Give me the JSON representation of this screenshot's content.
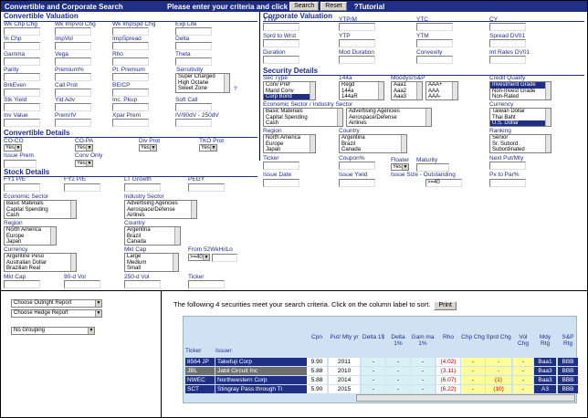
{
  "header": {
    "title": "Convertible and Corporate Search",
    "prompt": "Please enter your criteria and click",
    "search_label": "Search",
    "reset_label": "Reset",
    "tutorial_label": "?Tutorial"
  },
  "convertible_valuation": {
    "title": "Convertible Valuation",
    "fields": [
      "Wk Chp Chg",
      "Wk ImpVol Chg",
      "Wk ImpSpd Chg",
      "Exp Life",
      "% Chp",
      "ImpVol",
      "ImpSpread",
      "Delta",
      "Gamma",
      "Vega",
      "Rho",
      "Theta",
      "Parity",
      "Premium%",
      "Pt. Premium",
      "BrkEven",
      "Call Prot",
      "BE/CP",
      "Stk Yield",
      "Yld Adv",
      "Inc. Pkup",
      "Soft Call",
      "Inv Value",
      "Prem/IV",
      "Xpar Prem",
      "IV/90dV - 250dV"
    ],
    "sensitivity_label": "Sensitivity",
    "sensitivity_options": [
      "Super Charged",
      "High Octane",
      "Sweet Zone"
    ],
    "help": "?"
  },
  "corporate_valuation": {
    "title": "Corporate Valuation",
    "fields": [
      "YTW",
      "YTP/M",
      "YTC",
      "CY",
      "Sprd to Wrst",
      "YTP",
      "YTM",
      "Spread DV01",
      "Duration",
      "Mod Duration",
      "Convexity",
      "Int Rates DV01"
    ]
  },
  "security_details": {
    "title": "Security Details",
    "sec_type_label": "Sec Type",
    "sec_type_options": [
      "Conv Pref",
      "Mand Conv",
      "Corp Bond"
    ],
    "l144a_label": "144a",
    "l144a_options": [
      "Regd",
      "144a",
      "144aR"
    ],
    "moodys_label": "Moodys/S&P",
    "moodys_options": [
      "Aaa1",
      "Aaa2",
      "Aaa3"
    ],
    "sp_options": [
      "AAA+",
      "AAA",
      "AAA-"
    ],
    "credit_label": "Credit Quality",
    "credit_options": [
      "Investment Grade",
      "Non-Invest Grade",
      "Non-Rated"
    ],
    "econ_label": "Economic Sector / Industry Sector",
    "econ_options": [
      "Basic Materials",
      "Capital Spending",
      "Cash"
    ],
    "industry_options": [
      "Advertising Agencies",
      "Aerospace/Defense",
      "Airlines"
    ],
    "currency_label": "Currency",
    "currency_options": [
      "Taiwan Dollar",
      "Thai Baht",
      "U.S. Dollar"
    ],
    "region_label": "Region",
    "region_options": [
      "North America",
      "Europe",
      "Japan"
    ],
    "country_label": "Country",
    "country_options": [
      "Argentina",
      "Brazil",
      "Canada"
    ],
    "ranking_label": "Ranking",
    "ranking_options": [
      "Senior",
      "Sr. Subord.",
      "Subordinated"
    ],
    "ticker_label": "Ticker",
    "coupon_label": "Coupon%",
    "floater_label": "Floater",
    "floater_value": "Yes",
    "maturity_label": "Maturity",
    "next_put_label": "Next Put/Mty",
    "issue_date_label": "Issue Date",
    "issue_yield_label": "Issue Yield",
    "issue_size_label": "Issue Size  - Outstanding",
    "issue_size_value": ">=40",
    "px_par_label": "Px to Par%"
  },
  "convertible_details": {
    "title": "Convertible Details",
    "co_co_label": "CO-CO",
    "co_co_value": "Yes",
    "co_pa_label": "CO-PA",
    "co_pa_value": "Yes",
    "div_prot_label": "Div Prot",
    "div_prot_value": "Yes",
    "tko_prot_label": "TKO Prot",
    "tko_prot_value": "Yes",
    "issue_prem_label": "Issue Prem",
    "conv_only_label": "Conv Only",
    "conv_only_value": "Yes"
  },
  "stock_details": {
    "title": "Stock Details",
    "fy1_label": "FY1 P/E",
    "fy2_label": "FY2 P/E",
    "lt_growth_label": "LT Growth",
    "pegy_label": "PEGY",
    "econ_label": "Economic Sector",
    "econ_options": [
      "Basic Materials",
      "Capital Spending",
      "Cash"
    ],
    "industry_label": "Industry Sector",
    "industry_options": [
      "Advertising Agencies",
      "Aerospace/Defense",
      "Airlines"
    ],
    "region_label": "Region",
    "region_options": [
      "North America",
      "Europe",
      "Japan"
    ],
    "country_label": "Country",
    "country_options": [
      "Argentina",
      "Brazil",
      "Canada"
    ],
    "currency_label": "Currency",
    "currency_options": [
      "Argentine Peso",
      "Australian Dollar",
      "Brazilian Real"
    ],
    "mkt_cap_cat_label": "Mkt Cap",
    "mkt_cap_options": [
      "Large",
      "Medium",
      "Small"
    ],
    "from52_label": "From 52WkHi/Lo",
    "from52_value": ">=40",
    "mkt_cap_label": "Mkt Cap",
    "vol90_label": "90-d Vol",
    "vol250_label": "250-d Vol",
    "ticker_label": "Ticker"
  },
  "reports": {
    "outright": "Choose Outright Report",
    "hedge": "Choose Hedge Report",
    "grouping": "No Grouping"
  },
  "results": {
    "message": "The following 4 securities meet your search criteria. Click on the column label to sort.",
    "print_label": "Print",
    "columns": [
      "Ticker",
      "Issuer",
      "Cpn",
      "Put/ Mty yr",
      "Delta 1$",
      "Delta 1%",
      "Gam ma 1%",
      "Rho",
      "Chp Chg",
      "Sprd Chg",
      "Vol Chg",
      "Mdy Rtg",
      "S&P Rtg"
    ],
    "rows": [
      {
        "ticker": "8564 JP",
        "issuer": "Takefuji Corp",
        "cpn": "9.90",
        "mty": "2011",
        "d1": "-",
        "d2": "-",
        "gam": "-",
        "rho": "(4.02)",
        "chp": "-",
        "sprd": "-",
        "vol": "-",
        "mdy": "Baa1",
        "sp": "BBB"
      },
      {
        "ticker": "JBL",
        "issuer": "Jabil Circuit Inc",
        "cpn": "5.88",
        "mty": "2010",
        "d1": "-",
        "d2": "-",
        "gam": "-",
        "rho": "(3.11)",
        "chp": "-",
        "sprd": "-",
        "vol": "-",
        "mdy": "Baa3",
        "sp": "BBB"
      },
      {
        "ticker": "NWEC",
        "issuer": "Northwestern Corp",
        "cpn": "5.88",
        "mty": "2014",
        "d1": "-",
        "d2": "-",
        "gam": "-",
        "rho": "(6.07)",
        "chp": "-",
        "sprd": "(1)",
        "vol": "-",
        "mdy": "Baa3",
        "sp": "BBB"
      },
      {
        "ticker": "SCT",
        "issuer": "Stingray Pass through Tr",
        "cpn": "5.90",
        "mty": "2015",
        "d1": "-",
        "d2": "-",
        "gam": "-",
        "rho": "(6.22)",
        "chp": "-",
        "sprd": "(10)",
        "vol": "-",
        "mdy": "A3",
        "sp": "BBB"
      }
    ]
  },
  "colors": {
    "navy": "#1f2f86",
    "selected_row": "#6f6f6f",
    "yellow": "#ffff99",
    "grid_bg": "#cfe2f3"
  }
}
